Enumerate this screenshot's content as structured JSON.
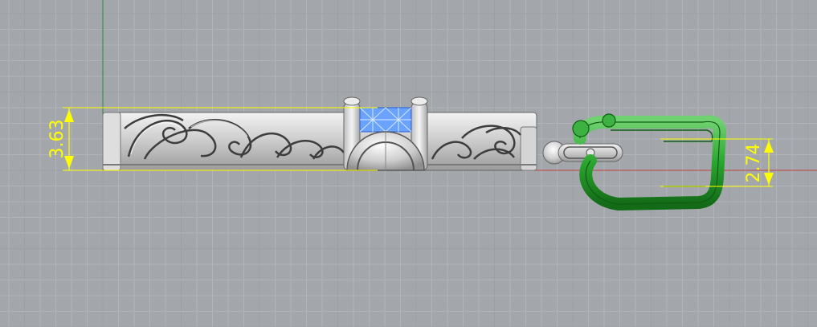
{
  "viewport": {
    "background": "#a3a7ab",
    "grid_minor_color": "#b1b5b9",
    "grid_major_color": "#9aa0a5",
    "axis_y_color": "#1f8f2a",
    "axis_x_color": "#c0403f"
  },
  "dimensions": [
    {
      "name": "height-left",
      "label": "3.63"
    },
    {
      "name": "height-right",
      "label": "2.74"
    }
  ],
  "colors": {
    "dimension": "#ffff00",
    "metal_light": "#eeeeee",
    "metal_mid": "#c9c9c9",
    "metal_dark": "#8a8a8a",
    "gem": "#6aa2ff",
    "clasp_green": "#2aa52f",
    "clasp_dark": "#0f5e13"
  }
}
